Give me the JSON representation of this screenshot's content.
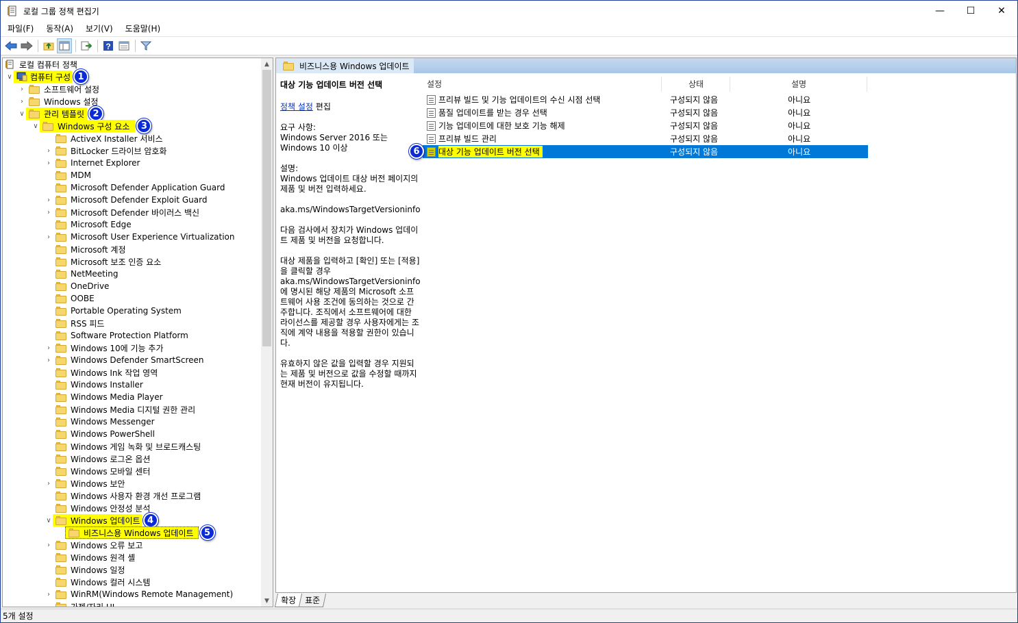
{
  "window": {
    "title": "로컬 그룹 정책 편집기",
    "controls": {
      "minimize": "—",
      "maximize": "☐",
      "close": "✕"
    }
  },
  "menu": [
    "파일(F)",
    "동작(A)",
    "보기(V)",
    "도움말(H)"
  ],
  "toolbar": {
    "icons": [
      "back-icon",
      "forward-icon",
      "up-folder-icon",
      "show-hide-tree-icon",
      "export-list-icon",
      "help-icon",
      "properties-icon",
      "filter-icon"
    ]
  },
  "tree": {
    "root": "로컬 컴퓨터 정책",
    "computer_config": "컴퓨터 구성",
    "software_settings": "소프트웨어 설정",
    "windows_settings": "Windows 설정",
    "admin_templates": "관리 템플릿",
    "windows_components": "Windows 구성 요소",
    "items": [
      "ActiveX Installer 서비스",
      "BitLocker 드라이브 암호화",
      "Internet Explorer",
      "MDM",
      "Microsoft Defender Application Guard",
      "Microsoft Defender Exploit Guard",
      "Microsoft Defender 바이러스 백신",
      "Microsoft Edge",
      "Microsoft User Experience Virtualization",
      "Microsoft 계정",
      "Microsoft 보조 인증 요소",
      "NetMeeting",
      "OneDrive",
      "OOBE",
      "Portable Operating System",
      "RSS 피드",
      "Software Protection Platform",
      "Windows 10에 기능 추가",
      "Windows Defender SmartScreen",
      "Windows Ink 작업 영역",
      "Windows Installer",
      "Windows Media Player",
      "Windows Media 디지털 권한 관리",
      "Windows Messenger",
      "Windows PowerShell",
      "Windows 게임 녹화 및 브로드캐스팅",
      "Windows 로그온 옵션",
      "Windows 모바일 센터",
      "Windows 보안",
      "Windows 사용자 환경 개선 프로그램",
      "Windows 안정성 분석"
    ],
    "windows_update": "Windows 업데이트",
    "wufb": "비즈니스용 Windows 업데이트",
    "after_items": [
      "Windows 오류 보고",
      "Windows 원격 셸",
      "Windows 일정",
      "Windows 컬러 시스템",
      "WinRM(Windows Remote Management)",
      "가젯/자리 UI"
    ],
    "badges": [
      "1",
      "2",
      "3",
      "4",
      "5"
    ]
  },
  "right": {
    "header_title": "비즈니스용 Windows 업데이트",
    "desc": {
      "title": "대상 기능 업데이트 버전 선택",
      "edit_link": "정책 설정",
      "edit_suffix": " 편집",
      "req_label": "요구 사항:",
      "req_text": "Windows Server 2016 또는 Windows 10 이상",
      "desc_label": "설명:",
      "p1": "Windows 업데이트 대상 버전 페이지의 제품 및 버전 입력하세요.",
      "p2": "aka.ms/WindowsTargetVersioninfo",
      "p3": "다음 검사에서 장치가 Windows 업데이트 제품 및 버전을 요청합니다.",
      "p4": "대상 제품을 입력하고 [확인] 또는 [적용]을 클릭할 경우 aka.ms/WindowsTargetVersioninfo에 명시된 해당 제품의 Microsoft 소프트웨어 사용 조건에 동의하는 것으로 간주합니다. 조직에서 소프트웨어에 대한 라이선스를 제공할 경우 사용자에게는 조직에 계약 내용을 적용할 권한이 있습니다.",
      "p5": "유효하지 않은 값을 입력할 경우 지원되는 제품 및 버전으로 값을 수정할 때까지 현재 버전이 유지됩니다."
    },
    "columns": {
      "setting": "설정",
      "state": "상태",
      "comment": "설명"
    },
    "rows": [
      {
        "name": "프리뷰 빌드 및 기능 업데이트의 수신 시점 선택",
        "state": "구성되지 않음",
        "comment": "아니요"
      },
      {
        "name": "품질 업데이트를 받는 경우 선택",
        "state": "구성되지 않음",
        "comment": "아니요"
      },
      {
        "name": "기능 업데이트에 대한 보호 기능 해제",
        "state": "구성되지 않음",
        "comment": "아니요"
      },
      {
        "name": "프리뷰 빌드 관리",
        "state": "구성되지 않음",
        "comment": "아니요"
      },
      {
        "name": "대상 기능 업데이트 버전 선택",
        "state": "구성되지 않음",
        "comment": "아니요"
      }
    ],
    "selected_badge": "6"
  },
  "tabs": {
    "extended": "확장",
    "standard": "표준"
  },
  "status": "5개 설정",
  "colors": {
    "highlight": "#ffff00",
    "badge": "#0b2bd6",
    "selection": "#0078d7"
  }
}
